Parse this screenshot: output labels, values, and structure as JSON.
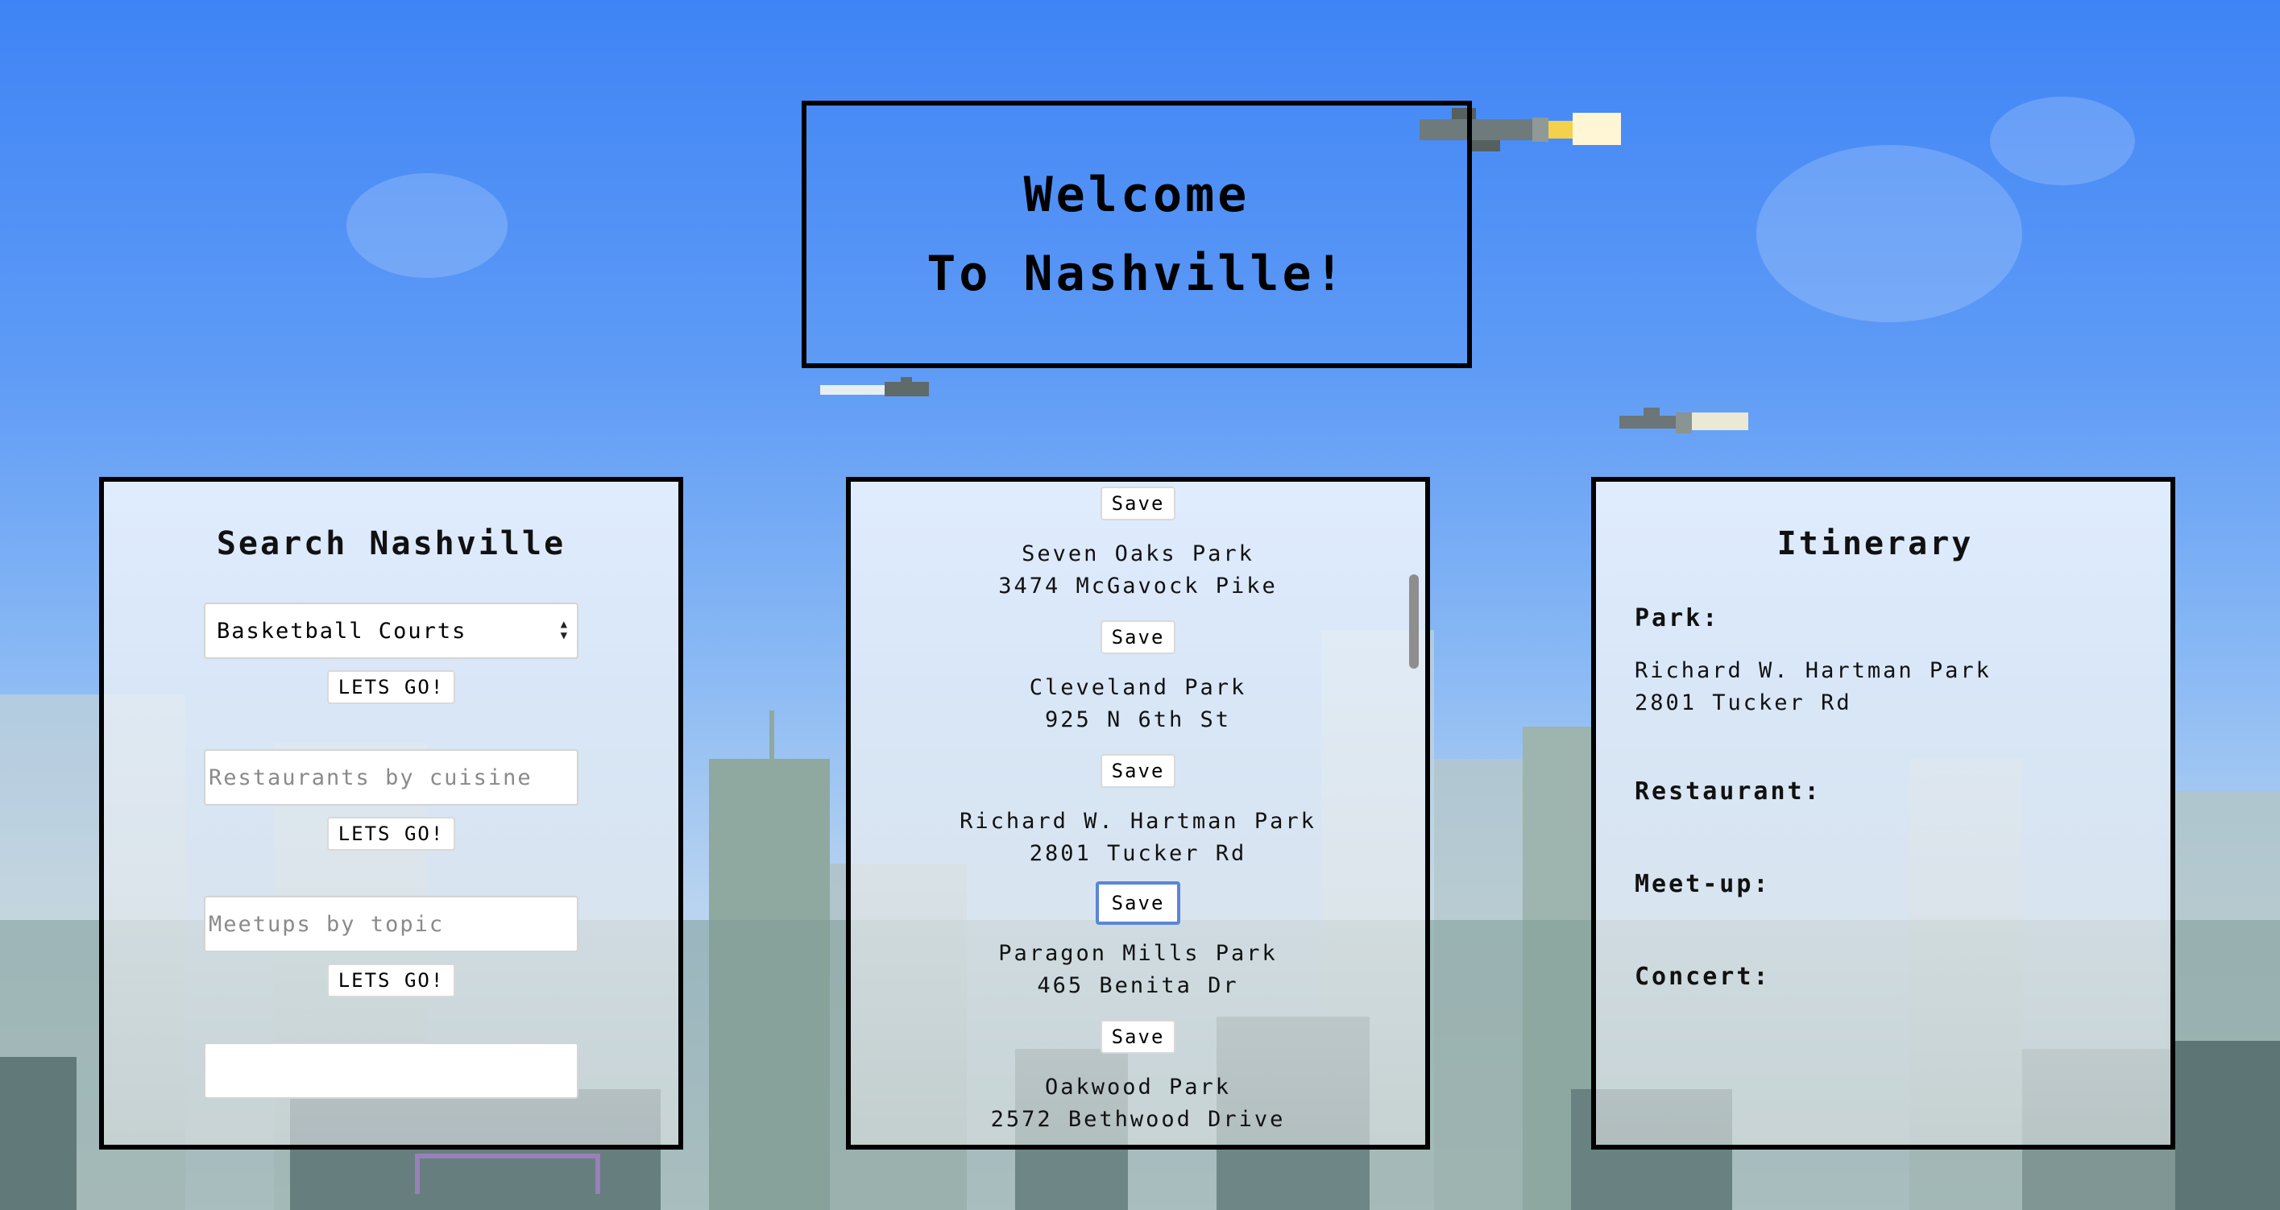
{
  "banner": {
    "line1": "Welcome",
    "line2": "To Nashville!"
  },
  "search": {
    "title": "Search Nashville",
    "select_value": "Basketball Courts",
    "go_label": "LETS GO!",
    "restaurants_placeholder": "Restaurants by cuisine",
    "meetups_placeholder": "Meetups by topic"
  },
  "results": {
    "save_label": "Save",
    "items": [
      {
        "name": "Seven Oaks Park",
        "address": "3474 McGavock Pike"
      },
      {
        "name": "Cleveland Park",
        "address": "925 N 6th St"
      },
      {
        "name": "Richard W. Hartman Park",
        "address": "2801 Tucker Rd"
      },
      {
        "name": "Paragon Mills Park",
        "address": "465 Benita Dr"
      },
      {
        "name": "Oakwood Park",
        "address": "2572 Bethwood Drive"
      }
    ]
  },
  "itinerary": {
    "title": "Itinerary",
    "park_label": "Park:",
    "park_name": "Richard W. Hartman Park",
    "park_address": "2801 Tucker Rd",
    "restaurant_label": "Restaurant:",
    "meetup_label": "Meet-up:",
    "concert_label": "Concert:"
  },
  "colors": {
    "sky_top": "#3f84f6",
    "sky_bottom": "#dbe6ee",
    "border": "#000000",
    "focus_ring": "#5b86d8"
  }
}
